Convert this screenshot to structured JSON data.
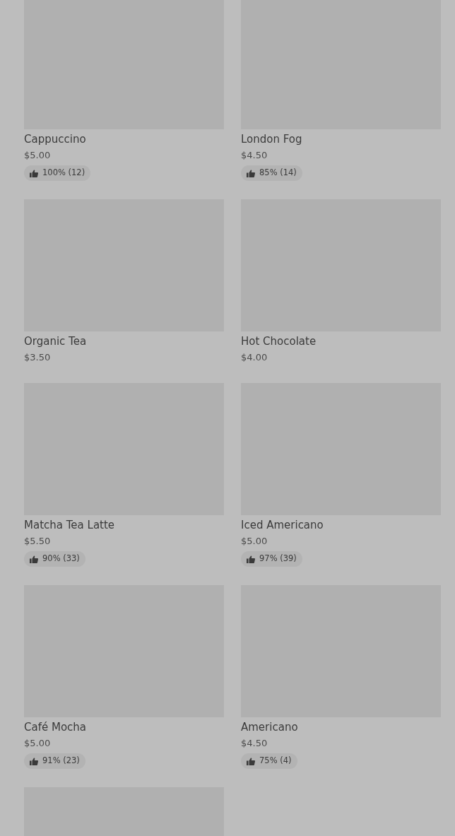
{
  "menu_items": [
    {
      "kind": "card",
      "name": "Cappuccino",
      "price": "$5.00",
      "rating": "100% (12)"
    },
    {
      "kind": "card",
      "name": "London Fog",
      "price": "$4.50",
      "rating": "85% (14)"
    },
    {
      "kind": "card",
      "name": "Organic Tea",
      "price": "$3.50"
    },
    {
      "kind": "card",
      "name": "Hot Chocolate",
      "price": "$4.00"
    },
    {
      "kind": "card",
      "name": "Matcha Tea Latte",
      "price": "$5.50",
      "rating": "90% (33)"
    },
    {
      "kind": "card",
      "name": "Iced Americano",
      "price": "$5.00",
      "rating": "97% (39)"
    },
    {
      "kind": "card",
      "name": "Café Mocha",
      "price": "$5.00",
      "rating": "91% (23)"
    },
    {
      "kind": "card",
      "name": "Americano",
      "price": "$4.50",
      "rating": "75% (4)"
    },
    {
      "kind": "image-only"
    }
  ]
}
